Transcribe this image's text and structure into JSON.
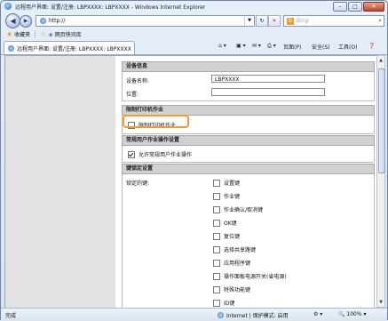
{
  "window": {
    "title": "远程用户界面: 设置/注册: LBPXXXX: LBPXXXX - Windows Internet Explorer",
    "min": "–",
    "max": "□",
    "close": "✕"
  },
  "nav": {
    "back": "◀",
    "forward": "▶",
    "url": "http://",
    "refresh": "✕",
    "go": "→",
    "stop": "✕",
    "search_placeholder": "Bing",
    "search_icon": "search-icon"
  },
  "favorites": {
    "label": "收藏夹",
    "suggested": "网页快讯库"
  },
  "tab": {
    "label": "远程用户界面: 设置/注册: LBPXXXX: LBPXXXX"
  },
  "commands": {
    "page": "页面(P)",
    "safety": "安全(S)",
    "tools": "工具(O)",
    "help": "❓"
  },
  "sections": {
    "device_info": {
      "header": "设备信息",
      "name_label": "设备名称:",
      "name_value": "LBPXXXX",
      "location_label": "位置:",
      "location_value": ""
    },
    "restrict_print": {
      "header": "限制打印机作业",
      "checkbox_label": "限制打印机作业",
      "checked": false
    },
    "user_ops": {
      "header": "常规用户作业操作设置",
      "checkbox_label": "允许常规用户作业操作",
      "checked": true
    },
    "key_lock": {
      "header": "键锁定设置",
      "label": "锁定的键:",
      "keys": [
        "设置键",
        "作业键",
        "作业确认/取消键",
        "OK键",
        "复位键",
        "选择共享路键",
        "应用程序键",
        "操作面板电源开关(省电源)",
        "特殊功能键",
        "ID键"
      ]
    }
  },
  "status": {
    "text": "完成",
    "zone": "Internet | 保护模式: 启用",
    "zoom": "100%"
  }
}
